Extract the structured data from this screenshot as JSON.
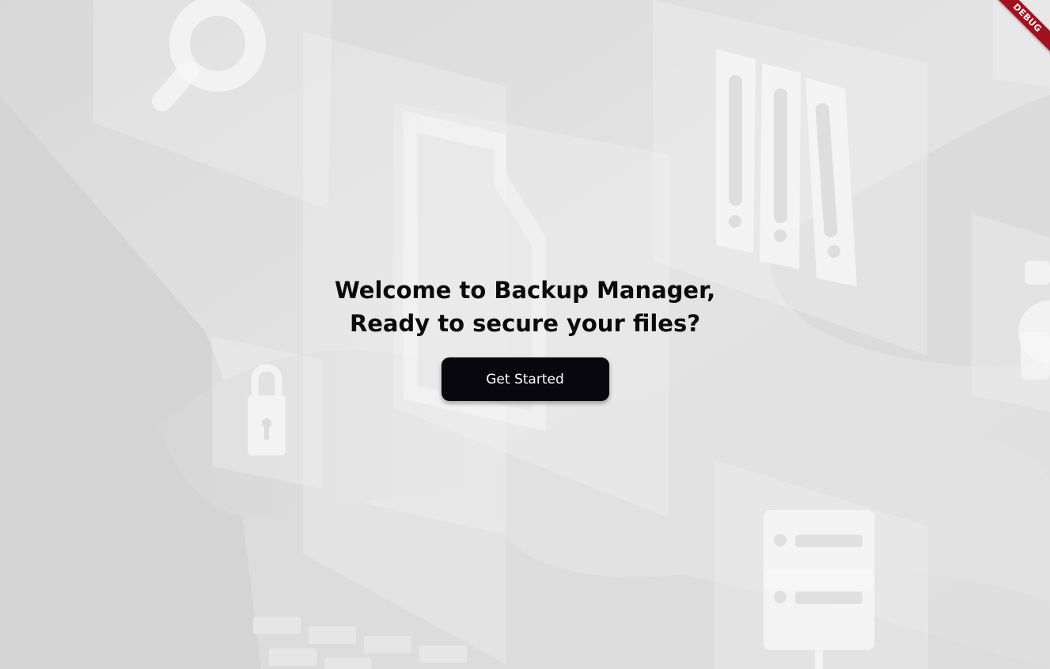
{
  "welcome": {
    "line1": "Welcome to Backup Manager,",
    "line2": "Ready to secure your files?"
  },
  "cta": {
    "label": "Get Started"
  },
  "debug_banner": {
    "label": "DEBUG"
  },
  "background": {
    "icons": [
      "search-icon",
      "document-icon",
      "binders-icon",
      "lock-icon",
      "server-icon",
      "gear-icon"
    ]
  },
  "colors": {
    "button_bg": "#07070d",
    "button_text": "#ffffff",
    "heading_text": "#0a0a0a",
    "ribbon": "#a3101f"
  }
}
